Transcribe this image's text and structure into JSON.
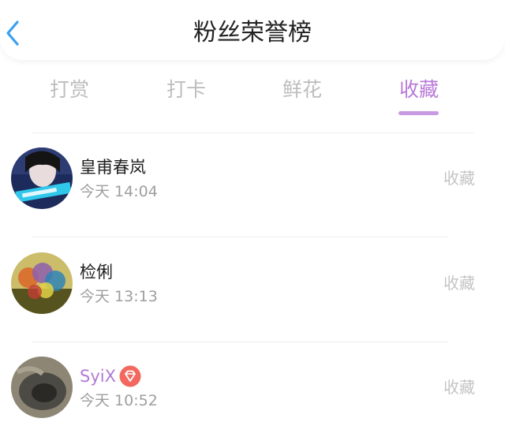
{
  "header": {
    "title": "粉丝荣誉榜",
    "back_icon": "chevron-left-icon",
    "accent": "#3aa0f0"
  },
  "tabs": [
    {
      "label": "打赏",
      "active": false
    },
    {
      "label": "打卡",
      "active": false
    },
    {
      "label": "鲜花",
      "active": false
    },
    {
      "label": "收藏",
      "active": true
    }
  ],
  "active_color": "#b87ad8",
  "fans": [
    {
      "name": "皇甫春岚",
      "time": "今天 14:04",
      "action": "收藏",
      "vip": false
    },
    {
      "name": "检俐",
      "time": "今天 13:13",
      "action": "收藏",
      "vip": false
    },
    {
      "name": "SyiX",
      "time": "今天 10:52",
      "action": "收藏",
      "vip": true,
      "badge_icon": "diamond-badge-icon"
    }
  ]
}
